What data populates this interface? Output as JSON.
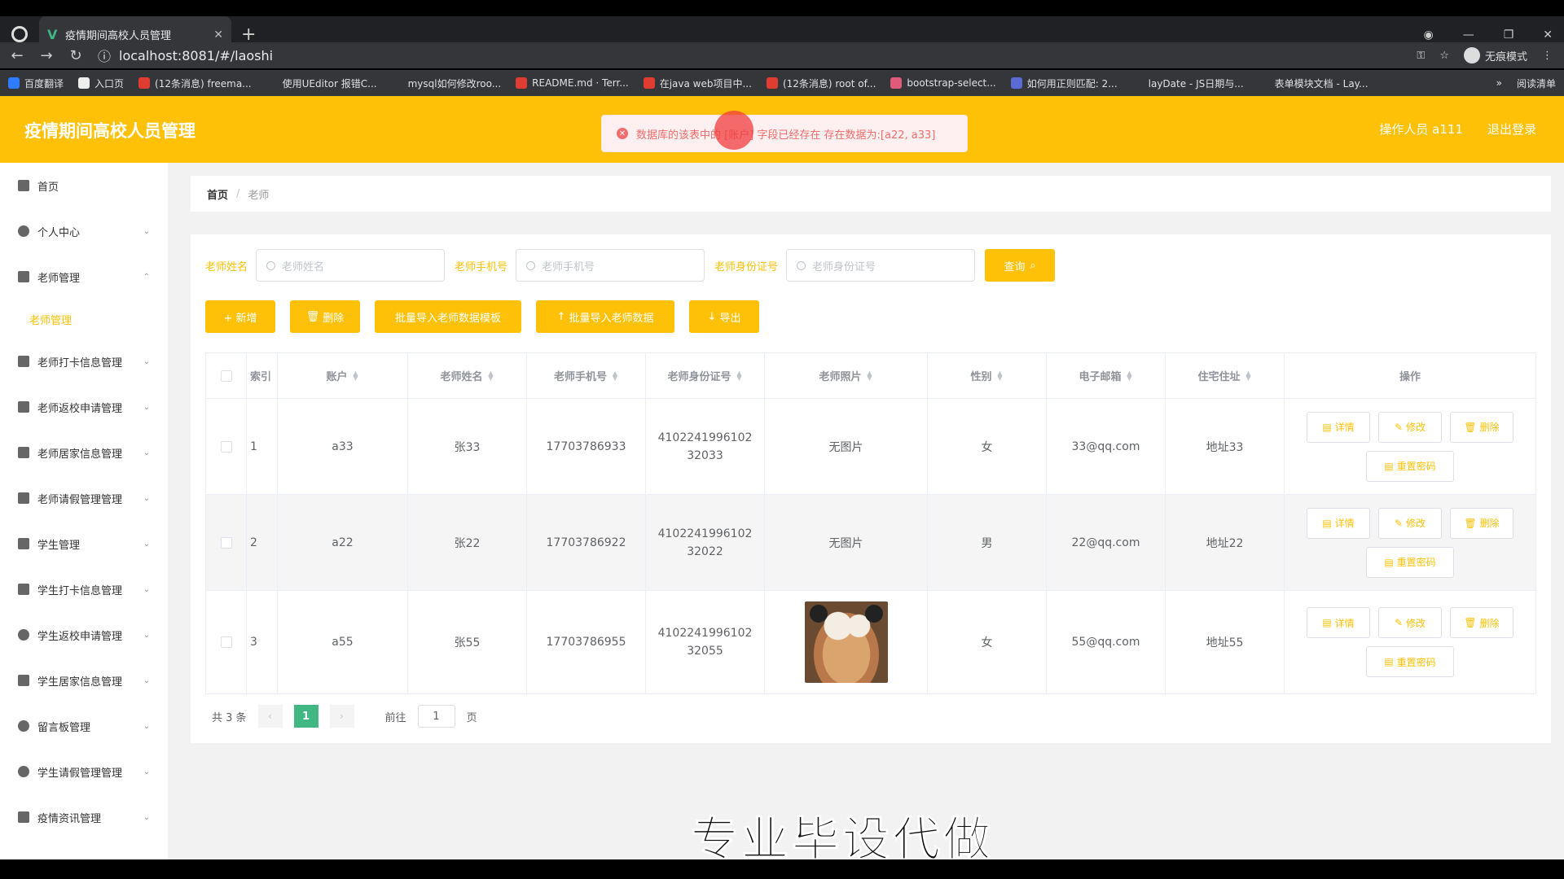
{
  "browser": {
    "tab_title": "疫情期间高校人员管理",
    "tab_favicon": "V",
    "new_tab": "+",
    "url": "localhost:8081/#/laoshi",
    "incognito_label": "无痕模式",
    "bookmarks": [
      {
        "label": "百度翻译",
        "color": "#2f7bff"
      },
      {
        "label": "入口页",
        "color": "#eeeeee"
      },
      {
        "label": "(12条消息) freema...",
        "color": "#e03c31"
      },
      {
        "label": "使用UEditor 报错C...",
        "color": "#35363a"
      },
      {
        "label": "mysql如何修改roo...",
        "color": "#35363a"
      },
      {
        "label": "README.md · Terr...",
        "color": "#e03c31"
      },
      {
        "label": "在java web项目中...",
        "color": "#e03c31"
      },
      {
        "label": "(12条消息) root of...",
        "color": "#e03c31"
      },
      {
        "label": "bootstrap-select...",
        "color": "#e05a7a"
      },
      {
        "label": "如何用正则匹配: 2...",
        "color": "#5b6bd5"
      },
      {
        "label": "layDate - JS日期与...",
        "color": "#35363a"
      },
      {
        "label": "表单模块文档 - Lay...",
        "color": "#35363a"
      }
    ],
    "bookmarks_more": "»",
    "reading_list": "阅读清单"
  },
  "header": {
    "title": "疫情期间高校人员管理",
    "operator": "操作人员 a111",
    "logout": "退出登录"
  },
  "toast": {
    "message": "数据库的该表中的 [账户] 字段已经存在 存在数据为:[a22, a33]"
  },
  "sidebar": {
    "items": [
      {
        "label": "首页",
        "chevron": ""
      },
      {
        "label": "个人中心",
        "chevron": "⌄"
      },
      {
        "label": "老师管理",
        "chevron": "⌃"
      }
    ],
    "sub_item": "老师管理",
    "items_after": [
      {
        "label": "老师打卡信息管理",
        "chevron": "⌄"
      },
      {
        "label": "老师返校申请管理",
        "chevron": "⌄"
      },
      {
        "label": "老师居家信息管理",
        "chevron": "⌄"
      },
      {
        "label": "老师请假管理管理",
        "chevron": "⌄"
      },
      {
        "label": "学生管理",
        "chevron": "⌄"
      },
      {
        "label": "学生打卡信息管理",
        "chevron": "⌄"
      },
      {
        "label": "学生返校申请管理",
        "chevron": "⌄"
      },
      {
        "label": "学生居家信息管理",
        "chevron": "⌄"
      },
      {
        "label": "留言板管理",
        "chevron": "⌄"
      },
      {
        "label": "学生请假管理管理",
        "chevron": "⌄"
      },
      {
        "label": "疫情资讯管理",
        "chevron": "⌄"
      }
    ]
  },
  "breadcrumb": {
    "home": "首页",
    "sep": "/",
    "current": "老师"
  },
  "search": {
    "name_label": "老师姓名",
    "name_placeholder": "老师姓名",
    "phone_label": "老师手机号",
    "phone_placeholder": "老师手机号",
    "idcard_label": "老师身份证号",
    "idcard_placeholder": "老师身份证号",
    "query_button": "查询"
  },
  "actions": {
    "add": "+ 新增",
    "delete": "删除",
    "import_template": "批量导入老师数据模板",
    "import_data": "批量导入老师数据",
    "export": "导出"
  },
  "table": {
    "headers": [
      "索引",
      "账户",
      "老师姓名",
      "老师手机号",
      "老师身份证号",
      "老师照片",
      "性别",
      "电子邮箱",
      "住宅住址",
      "操作"
    ],
    "rows": [
      {
        "index": "1",
        "account": "a33",
        "name": "张33",
        "phone": "17703786933",
        "idcard": "410224199610232033",
        "photo": "无图片",
        "gender": "女",
        "email": "33@qq.com",
        "address": "地址33"
      },
      {
        "index": "2",
        "account": "a22",
        "name": "张22",
        "phone": "17703786922",
        "idcard": "410224199610232022",
        "photo": "无图片",
        "gender": "男",
        "email": "22@qq.com",
        "address": "地址22"
      },
      {
        "index": "3",
        "account": "a55",
        "name": "张55",
        "phone": "17703786955",
        "idcard": "410224199610232055",
        "photo": "",
        "gender": "女",
        "email": "55@qq.com",
        "address": "地址55"
      }
    ],
    "op_detail": "详情",
    "op_edit": "修改",
    "op_delete": "删除",
    "op_reset": "重置密码"
  },
  "pager": {
    "total": "共 3 条",
    "prev": "‹",
    "page": "1",
    "next": "›",
    "goto": "前往",
    "goto_value": "1",
    "page_unit": "页"
  },
  "watermark": "专业毕设代做",
  "colors": {
    "accent": "#ffc107",
    "error": "#f56c6c",
    "pager_active": "#41b883"
  }
}
